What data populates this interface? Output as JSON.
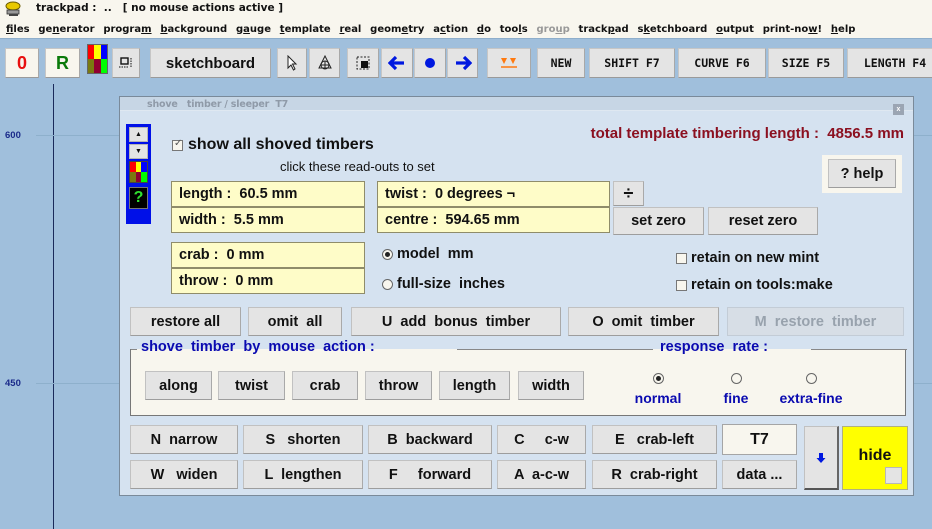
{
  "window": {
    "title": "trackpad :  ..   [ no mouse actions active ]"
  },
  "menu": [
    {
      "label": "files",
      "u": 0
    },
    {
      "label": "generator",
      "u": 2
    },
    {
      "label": "program",
      "u": 6
    },
    {
      "label": "background",
      "u": 0
    },
    {
      "label": "gauge",
      "u": 1
    },
    {
      "label": "template",
      "u": 0
    },
    {
      "label": "real",
      "u": 0
    },
    {
      "label": "geometry",
      "u": 4
    },
    {
      "label": "action",
      "u": 1
    },
    {
      "label": "do",
      "u": 0
    },
    {
      "label": "tools",
      "u": 3
    },
    {
      "label": "group",
      "u": 3,
      "disabled": true
    },
    {
      "label": "trackpad",
      "u": 5
    },
    {
      "label": "sketchboard",
      "u": 1
    },
    {
      "label": "output",
      "u": 0
    },
    {
      "label": "print-now!",
      "u": 8
    },
    {
      "label": "help",
      "u": 0
    }
  ],
  "toolbar": {
    "zero_label": "0",
    "r_label": "R",
    "sketchboard_label": "sketchboard",
    "new_label": "NEW",
    "shift_label": "SHIFT  F7",
    "curve_label": "CURVE  F6",
    "size_label": "SIZE  F5",
    "length_label": "LENGTH  F4",
    "colors": {
      "zero": "#e81010",
      "r": "#0a7a0a",
      "arrows": "#0018e0",
      "orange": "#ff7a10"
    }
  },
  "canvas": {
    "y_labels": [
      "600",
      "450"
    ]
  },
  "dialog": {
    "title": "shove   timber / sleeper  T7",
    "close_label": "x",
    "show_all_label": "show all shoved timbers",
    "show_all_checked": true,
    "hint": "click these read-outs to set",
    "total_label": "total template timbering length :  4856.5 mm",
    "total_color": "#8b1020",
    "help_label": "? help",
    "readouts": {
      "length": "length :  60.5 mm",
      "width": "width :  5.5 mm",
      "twist": "twist :  0 degrees ¬",
      "centre": "centre :  594.65 mm",
      "crab": "crab :  0 mm",
      "throw": "throw :  0 mm"
    },
    "divide_label": "÷",
    "set_zero_label": "set zero",
    "reset_zero_label": "reset zero",
    "units": {
      "model_label": "model  mm",
      "fullsize_label": "full-size  inches",
      "selected": "model"
    },
    "retain_new_mint_label": "retain on new mint",
    "retain_new_mint_checked": false,
    "retain_tools_make_label": "retain on tools:make",
    "retain_tools_make_checked": false,
    "restore_all_label": "restore all",
    "omit_all_label": "omit  all",
    "add_bonus_label": "U  add  bonus  timber",
    "omit_timber_label": "O  omit  timber",
    "restore_timber_label": "M  restore  timber",
    "mouse_action": {
      "legend": "shove  timber  by  mouse  action :",
      "buttons": [
        "along",
        "twist",
        "crab",
        "throw",
        "length",
        "width"
      ]
    },
    "response_rate": {
      "legend": "response  rate :",
      "options": [
        "normal",
        "fine",
        "extra-fine"
      ],
      "selected": "normal"
    },
    "keys": {
      "n_narrow": "N  narrow",
      "s_shorten": "S   shorten",
      "b_backward": "B  backward",
      "c_cw": "C     c-w",
      "e_crableft": "E   crab-left",
      "w_widen": "W   widen",
      "l_lengthen": "L  lengthen",
      "f_forward": "F     forward",
      "a_acw": "A  a-c-w",
      "r_crabright": "R  crab-right"
    },
    "timber_id": "T7",
    "data_label": "data ...",
    "hide_label": "hide"
  }
}
